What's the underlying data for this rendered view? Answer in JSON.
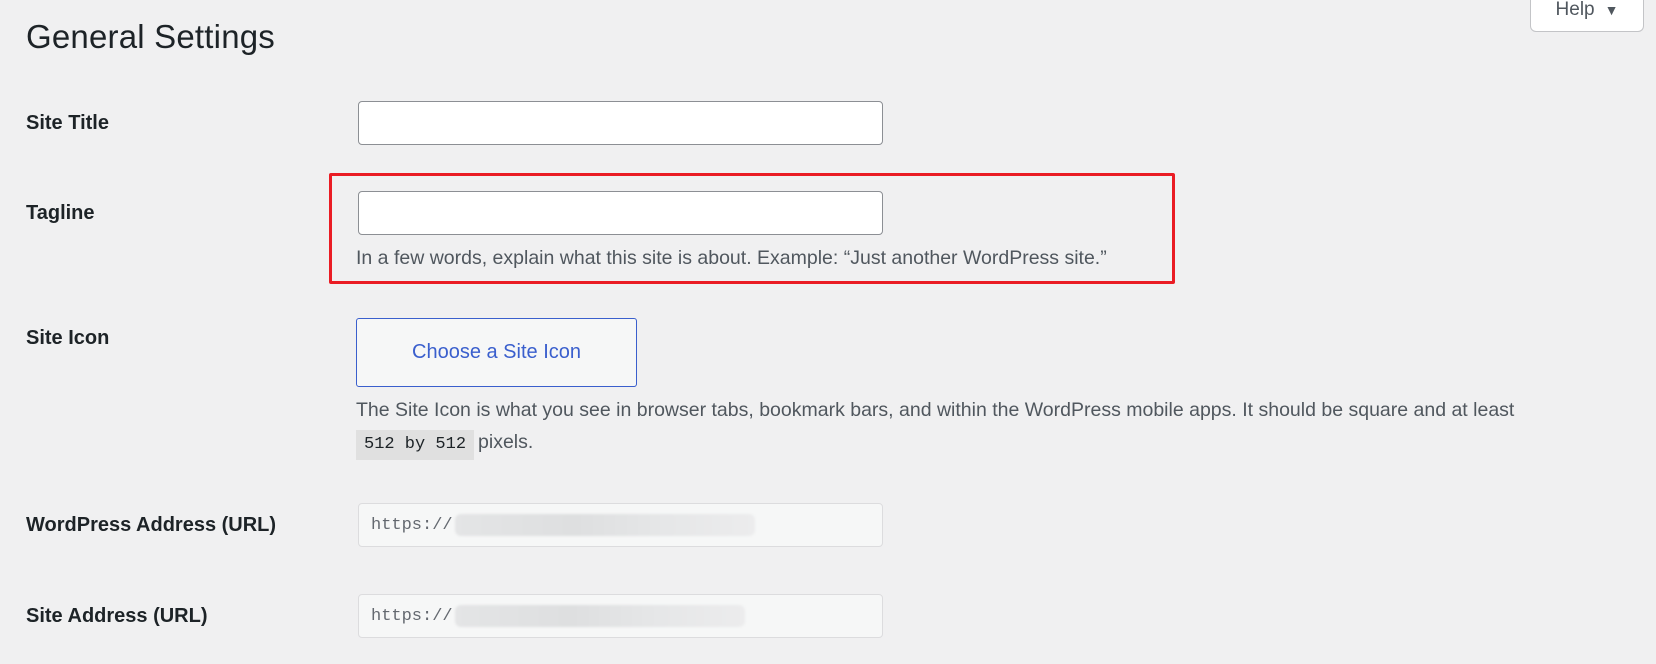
{
  "header": {
    "title": "General Settings",
    "help_label": "Help",
    "help_arrow": "▼"
  },
  "fields": {
    "site_title": {
      "label": "Site Title",
      "value": ""
    },
    "tagline": {
      "label": "Tagline",
      "value": "",
      "description": "In a few words, explain what this site is about. Example: “Just another WordPress site.”"
    },
    "site_icon": {
      "label": "Site Icon",
      "button_label": "Choose a Site Icon",
      "description_part1": "The Site Icon is what you see in browser tabs, bookmark bars, and within the WordPress mobile apps. It should be square and at least",
      "size_code": "512 by 512",
      "description_part2": "pixels."
    },
    "wordpress_address": {
      "label": "WordPress Address (URL)",
      "value_prefix": "https://"
    },
    "site_address": {
      "label": "Site Address (URL)",
      "value_prefix": "https://"
    }
  },
  "colors": {
    "highlight_border": "#ea1c24",
    "accent": "#3a5fcd",
    "background": "#f0f0f1"
  },
  "icons": {
    "help_arrow": "triangle-down-icon"
  }
}
